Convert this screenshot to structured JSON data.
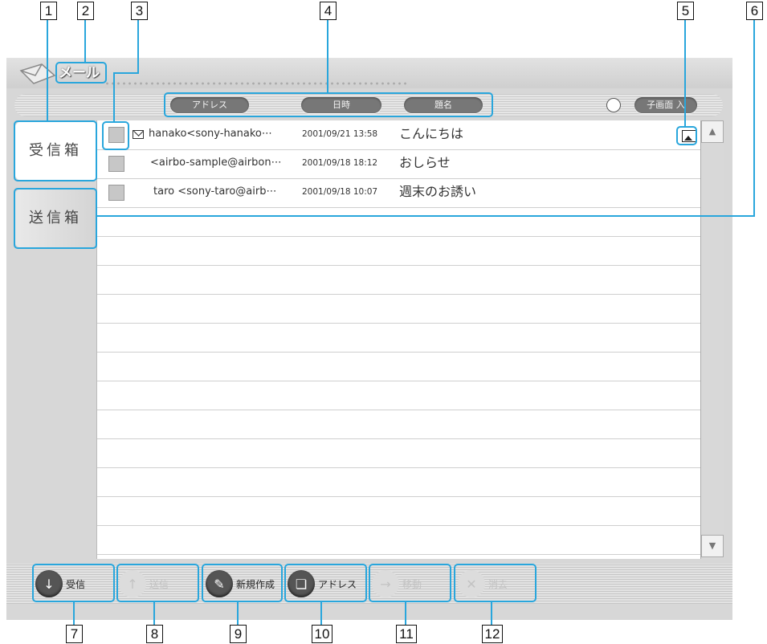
{
  "app": {
    "title": "メール"
  },
  "header": {
    "columns": [
      "アドレス",
      "日時",
      "題名"
    ],
    "subscreen_label": "子画面 入"
  },
  "tabs": [
    {
      "label": "受信箱"
    },
    {
      "label": "送信箱"
    }
  ],
  "messages": [
    {
      "sender": "hanako<sony-hanako⋯",
      "date": "2001/09/21 13:58",
      "subject": "こんにちは",
      "unread_icon": "envelope-icon",
      "attachment_icon": "image-icon"
    },
    {
      "sender": "<airbo-sample@airbon⋯",
      "date": "2001/09/18 18:12",
      "subject": "おしらせ"
    },
    {
      "sender": "taro <sony-taro@airb⋯",
      "date": "2001/09/18 10:07",
      "subject": "週末のお誘い"
    }
  ],
  "toolbar": {
    "buttons": [
      {
        "label": "受信",
        "icon": "receive-icon",
        "enabled": true
      },
      {
        "label": "送信",
        "icon": "send-icon",
        "enabled": false
      },
      {
        "label": "新規作成",
        "icon": "compose-icon",
        "enabled": true
      },
      {
        "label": "アドレス",
        "icon": "address-book-icon",
        "enabled": true
      },
      {
        "label": "移動",
        "icon": "move-icon",
        "enabled": false
      },
      {
        "label": "消去",
        "icon": "delete-icon",
        "enabled": false
      }
    ]
  },
  "callouts": [
    "1",
    "2",
    "3",
    "4",
    "5",
    "6",
    "7",
    "8",
    "9",
    "10",
    "11",
    "12"
  ],
  "colors": {
    "callout_line": "#29a6dc",
    "pill": "#777777"
  }
}
